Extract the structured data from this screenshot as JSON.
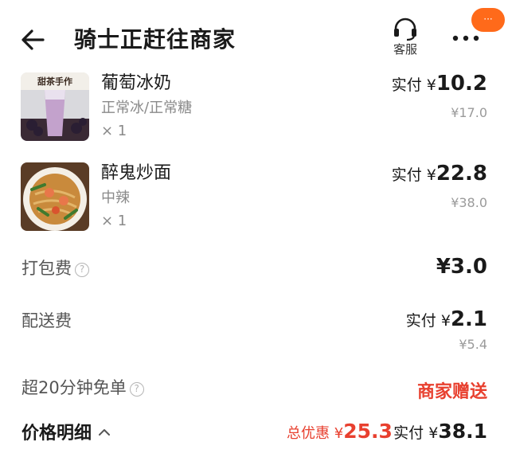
{
  "header": {
    "title": "骑士正赶往商家",
    "service_label": "客服",
    "badge": "···"
  },
  "items": [
    {
      "name": "葡萄冰奶",
      "spec": "正常冰/正常糖",
      "qty": "× 1",
      "paid_label": "实付 ¥",
      "paid_value": "10.2",
      "original": "¥17.0",
      "thumb_caption": "甜茶手作"
    },
    {
      "name": "醉鬼炒面",
      "spec": "中辣",
      "qty": "× 1",
      "paid_label": "实付 ¥",
      "paid_value": "22.8",
      "original": "¥38.0"
    }
  ],
  "fees": {
    "packing_label": "打包费",
    "packing_value": "¥3.0",
    "delivery_label": "配送费",
    "delivery_paid_label": "实付 ¥",
    "delivery_paid_value": "2.1",
    "delivery_original": "¥5.4",
    "overtime_label": "超20分钟免单",
    "overtime_value": "商家赠送"
  },
  "summary": {
    "detail_label": "价格明细",
    "discount_label": "总优惠 ¥",
    "discount_value": "25.3",
    "total_label": "实付 ¥",
    "total_value": "38.1"
  },
  "colors": {
    "accent_red": "#e8402f",
    "badge_orange": "#ff6a1a"
  },
  "icons": {
    "back": "arrow-left-icon",
    "service": "headset-icon",
    "more": "more-dots-icon",
    "info": "question-circle-icon",
    "caret": "chevron-up-icon"
  }
}
